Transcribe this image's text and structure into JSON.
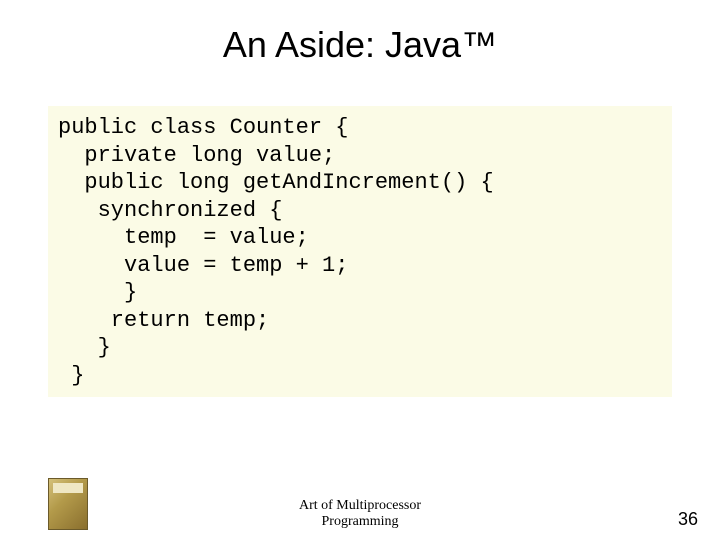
{
  "title": "An Aside: Java™",
  "code": {
    "l1": "public class Counter {",
    "l2": "  private long value;",
    "l3": "",
    "l4": "  public long getAndIncrement() {",
    "l5": "   synchronized {",
    "l6": "     temp  = value;",
    "l7": "     value = temp + 1;",
    "l8": "     }",
    "l9": "    return temp;",
    "l10": "   }",
    "l11": " }"
  },
  "footer": {
    "line1": "Art of Multiprocessor",
    "line2": "Programming"
  },
  "page_number": "36"
}
